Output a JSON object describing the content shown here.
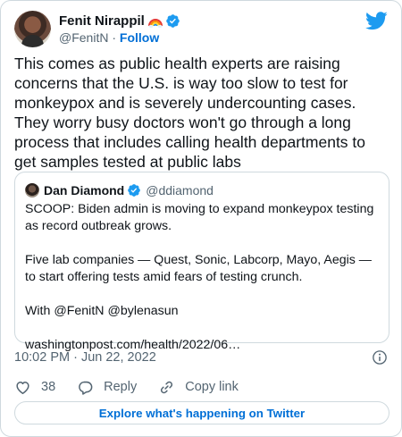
{
  "author": {
    "display_name": "Fenit Nirappil",
    "handle": "@FenitN",
    "separator": " · ",
    "follow_label": "Follow"
  },
  "tweet": {
    "text": "This comes as public health experts are raising concerns that the U.S. is way too slow to test for monkeypox and is severely undercounting cases. They worry busy doctors won't go through a long process that includes calling health departments to get samples tested at public labs",
    "timestamp": "10:02 PM · Jun 22, 2022"
  },
  "quoted_tweet": {
    "display_name": "Dan Diamond",
    "handle": "@ddiamond",
    "text": "SCOOP: Biden admin is moving to expand monkeypox testing as record outbreak grows.\n\nFive lab companies — Quest, Sonic, Labcorp, Mayo, Aegis — to start offering tests amid fears of testing crunch.\n\nWith @FenitN @bylenasun\n\nwashingtonpost.com/health/2022/06…"
  },
  "actions": {
    "like_count": "38",
    "reply_label": "Reply",
    "copy_link_label": "Copy link"
  },
  "footer": {
    "explore_label": "Explore what's happening on Twitter"
  },
  "icons": {
    "brand": "twitter-bird-icon",
    "verified": "verified-badge-icon",
    "emoji": "rainbow-emoji-icon",
    "info": "info-icon",
    "like": "heart-icon",
    "reply": "reply-bubble-icon",
    "copy": "link-icon"
  },
  "colors": {
    "brand_blue": "#1d9bf0",
    "link_blue": "#006fd6",
    "secondary_text": "#536471",
    "border": "#cfd9de"
  }
}
